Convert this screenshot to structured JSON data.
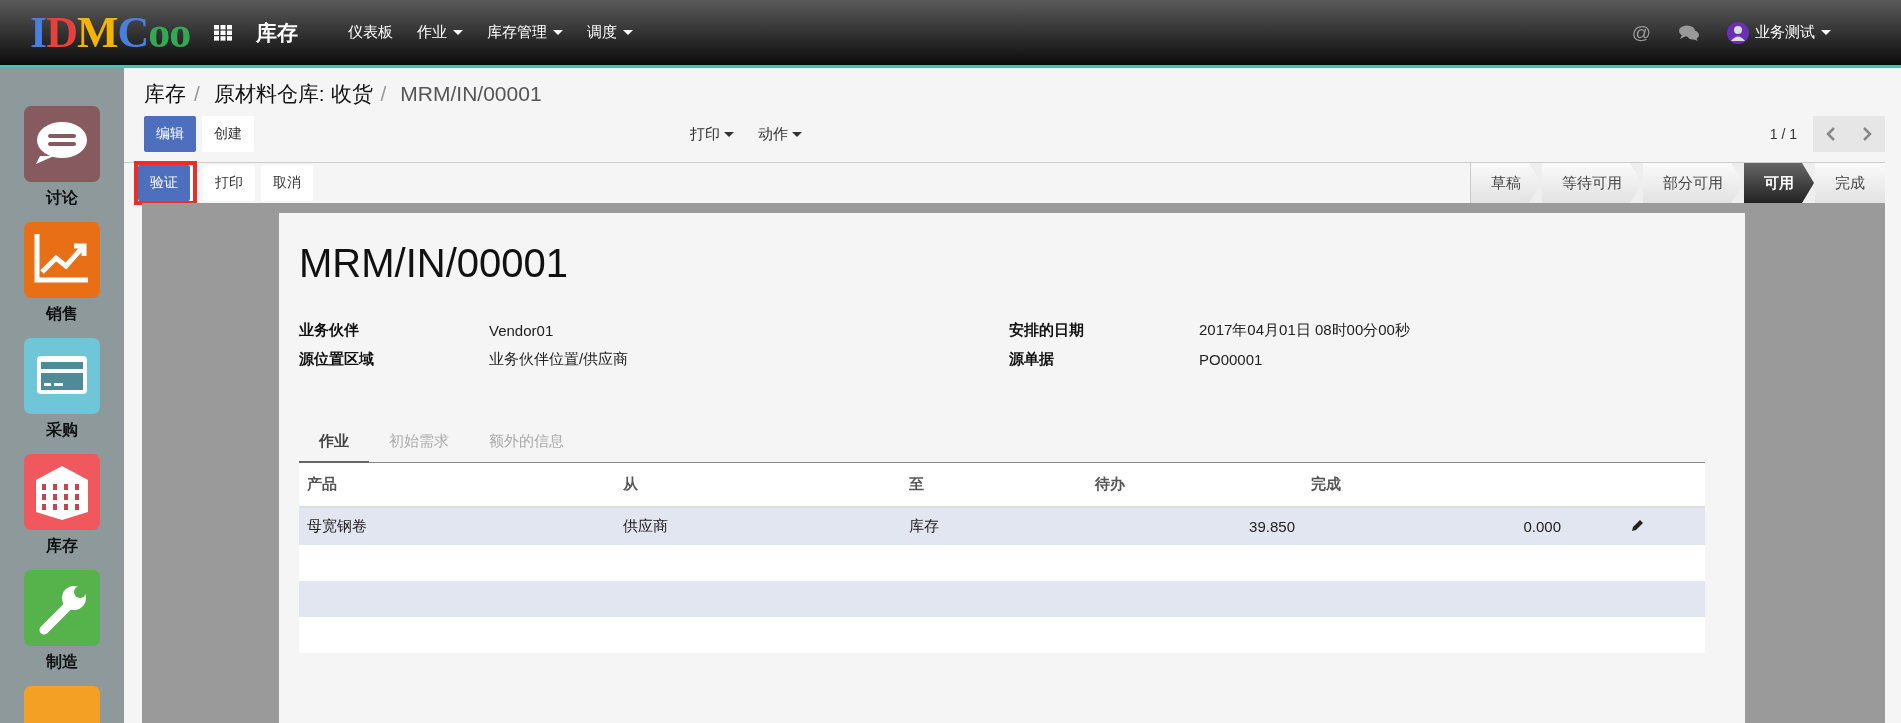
{
  "topbar": {
    "logo": [
      {
        "text": "I",
        "color": "#4a7fe0"
      },
      {
        "text": "D",
        "color": "#e8403a"
      },
      {
        "text": "M",
        "color": "#f4b400"
      },
      {
        "text": "C",
        "color": "#4a7fe0"
      },
      {
        "text": "o",
        "color": "#34a853"
      },
      {
        "text": "o",
        "color": "#34a853"
      }
    ],
    "app_title": "库存",
    "menu": [
      {
        "label": "仪表板",
        "dropdown": false
      },
      {
        "label": "作业",
        "dropdown": true
      },
      {
        "label": "库存管理",
        "dropdown": true
      },
      {
        "label": "调度",
        "dropdown": true
      }
    ],
    "mention_icon": "@",
    "user": "业务测试"
  },
  "sidebar": {
    "items": [
      {
        "kind": "chat",
        "label": "讨论"
      },
      {
        "kind": "sales",
        "label": "销售"
      },
      {
        "kind": "purchase",
        "label": "采购"
      },
      {
        "kind": "inventory",
        "label": "库存"
      },
      {
        "kind": "manufacturing",
        "label": "制造"
      },
      {
        "kind": "partial"
      }
    ]
  },
  "breadcrumb": [
    {
      "text": "库存",
      "current": false,
      "separator": "/"
    },
    {
      "text": "原材料仓库: 收货",
      "current": false,
      "separator": "/"
    },
    {
      "text": "MRM/IN/00001",
      "current": true
    }
  ],
  "buttons": {
    "edit": "编辑",
    "create": "创建",
    "print_menu": "打印",
    "action_menu": "动作",
    "pager": "1 / 1"
  },
  "header_buttons": [
    {
      "label": "验证",
      "primary": true,
      "highlighted": true
    },
    {
      "label": "打印",
      "primary": false,
      "highlighted": false
    },
    {
      "label": "取消",
      "primary": false,
      "highlighted": false
    }
  ],
  "stages": [
    {
      "label": "草稿",
      "selected": false
    },
    {
      "label": "等待可用",
      "selected": false
    },
    {
      "label": "部分可用",
      "selected": false
    },
    {
      "label": "可用",
      "selected": true
    },
    {
      "label": "完成",
      "selected": false
    }
  ],
  "form": {
    "title": "MRM/IN/00001",
    "left_fields": [
      {
        "label": "业务伙伴",
        "value": "Vendor01"
      },
      {
        "label": "源位置区域",
        "value": "业务伙伴位置/供应商"
      }
    ],
    "right_fields": [
      {
        "label": "安排的日期",
        "value": "2017年04月01日 08时00分00秒"
      },
      {
        "label": "源单据",
        "value": "PO00001"
      }
    ],
    "tabs": [
      {
        "label": "作业",
        "selected": true
      },
      {
        "label": "初始需求",
        "selected": false
      },
      {
        "label": "额外的信息",
        "selected": false
      }
    ],
    "table": {
      "columns": [
        "产品",
        "从",
        "至",
        "待办",
        "完成"
      ],
      "rows": [
        {
          "product": "母宽钢卷",
          "from": "供应商",
          "to": "库存",
          "todo": "39.850",
          "done": "0.000"
        }
      ]
    }
  }
}
